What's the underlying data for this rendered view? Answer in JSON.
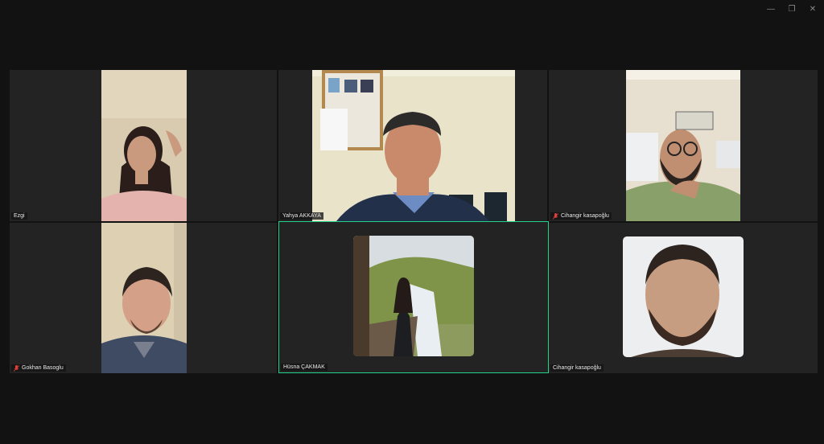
{
  "window": {
    "controls": [
      "minimize",
      "restore",
      "close"
    ],
    "minimize_glyph": "—",
    "restore_glyph": "❐",
    "close_glyph": "✕"
  },
  "participants": [
    {
      "name": "Ezgi",
      "muted": false,
      "video": "webcam",
      "active": false
    },
    {
      "name": "Yahya AKKAYA",
      "muted": false,
      "video": "webcam",
      "active": false
    },
    {
      "name": "Cihangir kasapoğlu",
      "muted": true,
      "video": "webcam",
      "active": false
    },
    {
      "name": "Gokhan Basoglu",
      "muted": true,
      "video": "webcam",
      "active": false
    },
    {
      "name": "Hüsna ÇAKMAK",
      "muted": false,
      "video": "profile-photo",
      "active": true
    },
    {
      "name": "Cihangir kasapoğlu",
      "muted": false,
      "video": "profile-photo",
      "active": false
    }
  ],
  "colors": {
    "background": "#121212",
    "tile": "#232323",
    "active_speaker_border": "#23d18b",
    "muted_icon": "#e0403a"
  }
}
